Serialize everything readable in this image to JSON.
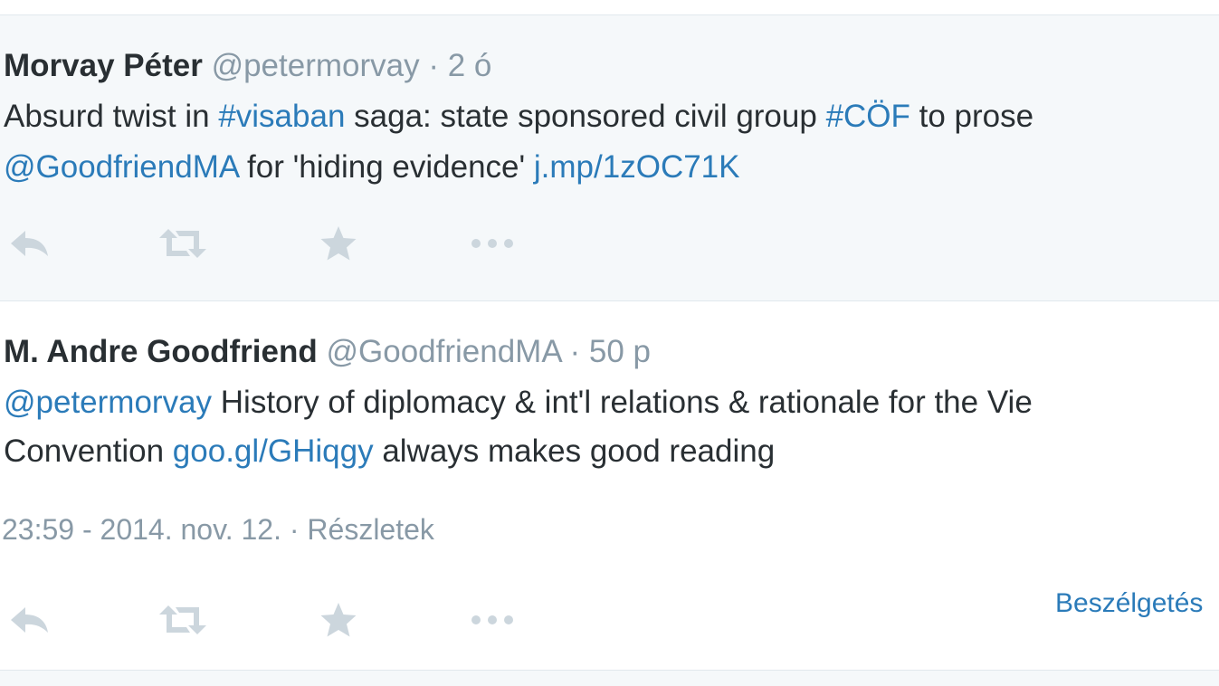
{
  "tweets": [
    {
      "name": "Morvay Péter",
      "handle": "@petermorvay",
      "separator": " · ",
      "time": "2 ó",
      "line1": {
        "t1": "Absurd twist in ",
        "hashtag1": "#visaban",
        "t2": " saga: state sponsored civil group ",
        "hashtag2": "#CÖF",
        "t3": " to prose"
      },
      "line2": {
        "mention": "@GoodfriendMA",
        "t1": " for 'hiding evidence' ",
        "link": "j.mp/1zOC71K"
      },
      "actions": [
        "reply-icon",
        "retweet-icon",
        "favorite-icon",
        "more-icon"
      ]
    },
    {
      "name": "M. Andre Goodfriend",
      "handle": "@GoodfriendMA",
      "separator": " · ",
      "time": "50 p",
      "line1": {
        "mention": "@petermorvay",
        "t1": " History of diplomacy & int'l relations & rationale for the Vie"
      },
      "line2": {
        "t1": "Convention ",
        "link": "goo.gl/GHiqgy",
        "t2": " always makes good reading"
      },
      "meta": {
        "timestamp": "23:59 - 2014. nov. 12.",
        "separator": " · ",
        "details_link": "Részletek"
      },
      "conversation_link": "Beszélgetés",
      "actions": [
        "reply-icon",
        "retweet-icon",
        "favorite-icon",
        "more-icon"
      ]
    }
  ],
  "colors": {
    "link": "#2b7bb9",
    "text": "#292f33",
    "muted": "#8899a6",
    "icon": "#ccd6dd",
    "highlight_bg": "#f5f8fa",
    "border": "#e1e8ed"
  }
}
